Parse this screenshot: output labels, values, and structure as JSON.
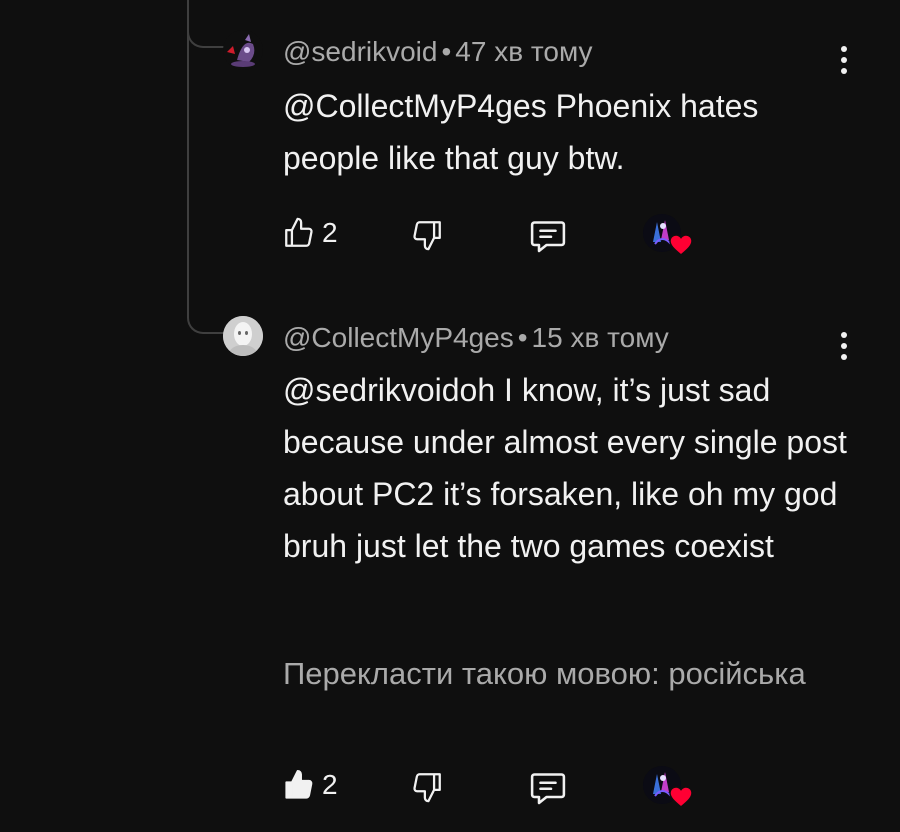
{
  "comments": [
    {
      "author": "@sedrikvoid",
      "separator": "•",
      "time": "47 хв тому",
      "text": "@CollectMyP4ges Phoenix hates people like that guy btw.",
      "like_count": "2",
      "liked": false
    },
    {
      "author": "@CollectMyP4ges",
      "separator": "•",
      "time": "15 хв тому",
      "text": "@sedrikvoidoh I know, it’s just sad because under almost every single post about PC2 it’s forsaken, like oh my god bruh just let the two games coexist",
      "translate": "Перекласти такою мовою: російська",
      "like_count": "2",
      "liked": true
    }
  ],
  "icons": {
    "like": "thumb-up-icon",
    "dislike": "thumb-down-icon",
    "reply": "reply-icon",
    "menu": "more-vertical-icon",
    "creator_heart": "creator-heart-icon"
  },
  "colors": {
    "background": "#0f0f0f",
    "text": "#f1f1f1",
    "secondary_text": "#aaaaaa",
    "heart": "#ff0033"
  }
}
